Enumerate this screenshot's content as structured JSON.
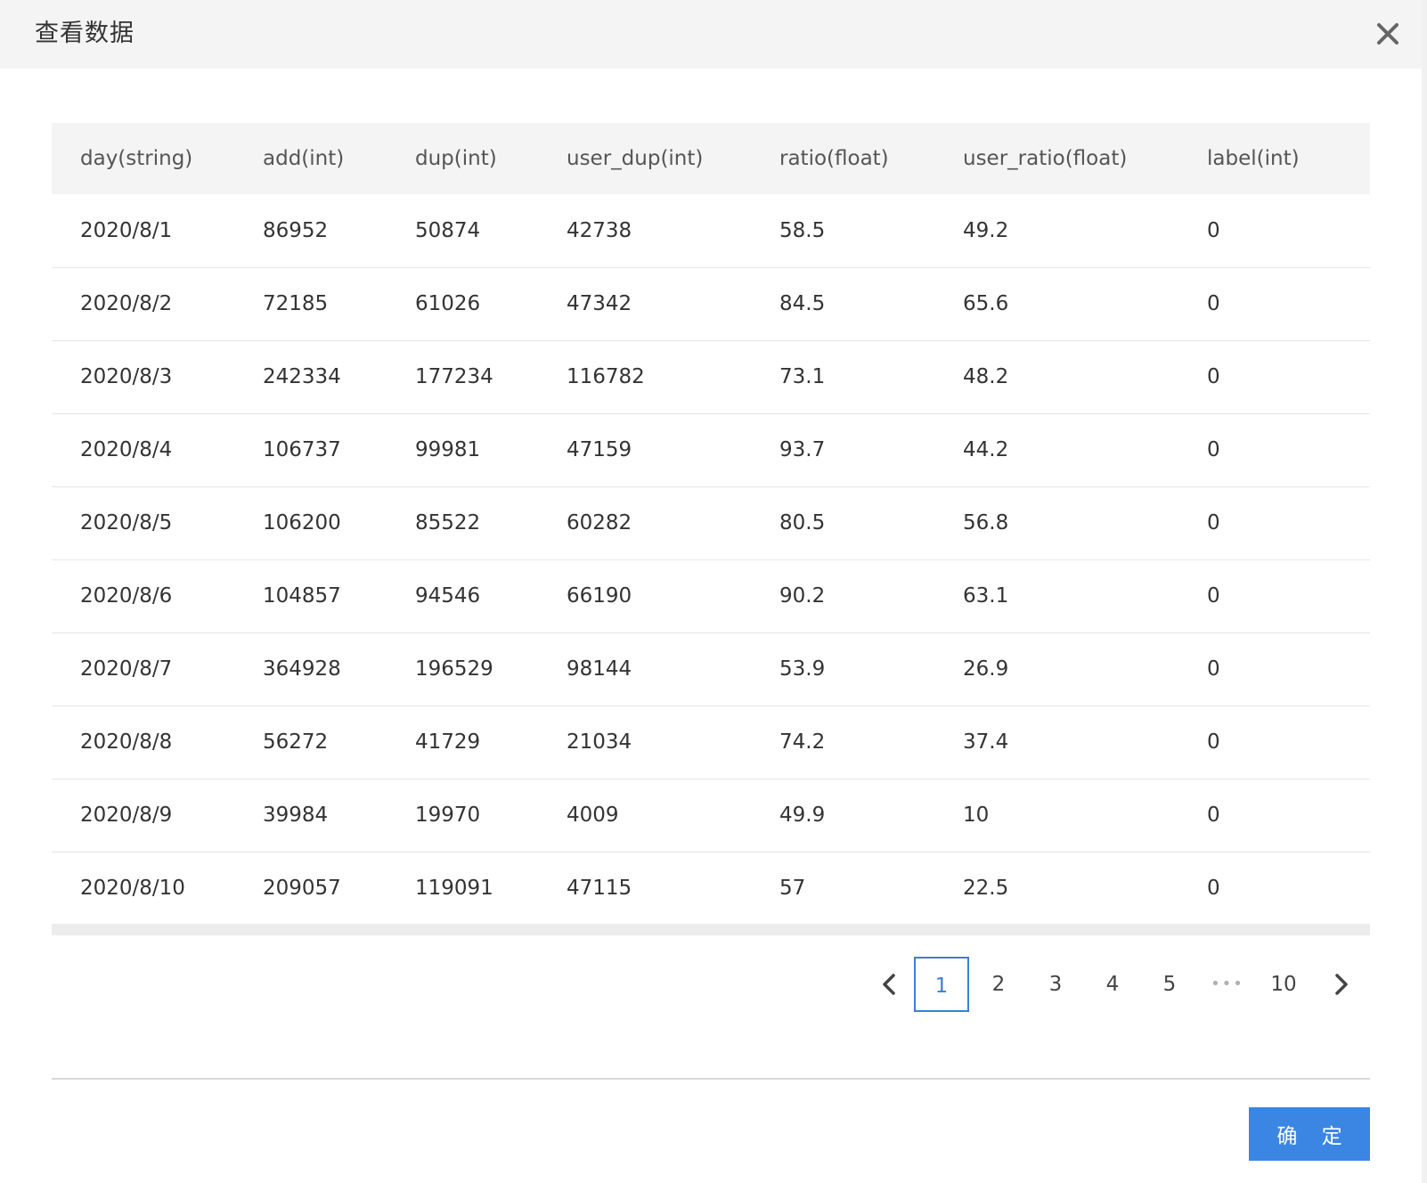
{
  "dialog": {
    "title": "查看数据",
    "confirm_label": "确 定"
  },
  "table": {
    "columns": [
      "day(string)",
      "add(int)",
      "dup(int)",
      "user_dup(int)",
      "ratio(float)",
      "user_ratio(float)",
      "label(int)"
    ],
    "rows": [
      [
        "2020/8/1",
        "86952",
        "50874",
        "42738",
        "58.5",
        "49.2",
        "0"
      ],
      [
        "2020/8/2",
        "72185",
        "61026",
        "47342",
        "84.5",
        "65.6",
        "0"
      ],
      [
        "2020/8/3",
        "242334",
        "177234",
        "116782",
        "73.1",
        "48.2",
        "0"
      ],
      [
        "2020/8/4",
        "106737",
        "99981",
        "47159",
        "93.7",
        "44.2",
        "0"
      ],
      [
        "2020/8/5",
        "106200",
        "85522",
        "60282",
        "80.5",
        "56.8",
        "0"
      ],
      [
        "2020/8/6",
        "104857",
        "94546",
        "66190",
        "90.2",
        "63.1",
        "0"
      ],
      [
        "2020/8/7",
        "364928",
        "196529",
        "98144",
        "53.9",
        "26.9",
        "0"
      ],
      [
        "2020/8/8",
        "56272",
        "41729",
        "21034",
        "74.2",
        "37.4",
        "0"
      ],
      [
        "2020/8/9",
        "39984",
        "19970",
        "4009",
        "49.9",
        "10",
        "0"
      ],
      [
        "2020/8/10",
        "209057",
        "119091",
        "47115",
        "57",
        "22.5",
        "0"
      ]
    ]
  },
  "pagination": {
    "pages": [
      "1",
      "2",
      "3",
      "4",
      "5"
    ],
    "ellipsis": "•••",
    "last_page": "10",
    "current": "1"
  },
  "icons": {
    "close": "close-icon",
    "prev": "chevron-left-icon",
    "next": "chevron-right-icon"
  },
  "colors": {
    "accent": "#3b86e3",
    "header_bg": "#f4f4f4"
  }
}
